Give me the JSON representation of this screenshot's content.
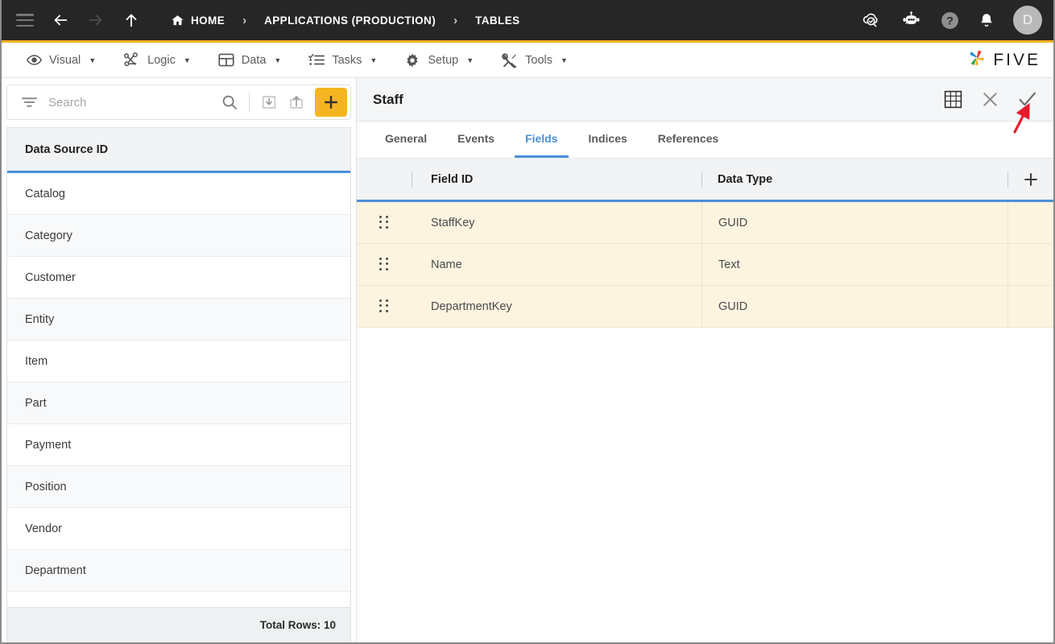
{
  "topbar": {
    "menu_icon": "hamburger-icon",
    "back_icon": "arrow-left-icon",
    "forward_icon": "arrow-right-icon",
    "up_icon": "arrow-up-icon",
    "breadcrumbs": [
      {
        "label": "HOME",
        "icon": "home-icon"
      },
      {
        "label": "APPLICATIONS (PRODUCTION)",
        "icon": ""
      },
      {
        "label": "TABLES",
        "icon": ""
      }
    ],
    "separator": "›",
    "right_icons": [
      {
        "name": "cloud-search-icon"
      },
      {
        "name": "robot-assistant-icon"
      },
      {
        "name": "help-icon"
      },
      {
        "name": "notifications-bell-icon"
      }
    ],
    "avatar_initial": "D",
    "accent_color": "#f5b120",
    "background_color": "#262626"
  },
  "menubar": {
    "items": [
      {
        "label": "Visual",
        "icon": "eye-icon",
        "caret": "▼"
      },
      {
        "label": "Logic",
        "icon": "logic-nodes-icon",
        "caret": "▼"
      },
      {
        "label": "Data",
        "icon": "table-grid-icon",
        "caret": "▼"
      },
      {
        "label": "Tasks",
        "icon": "checklist-icon",
        "caret": "▼"
      },
      {
        "label": "Setup",
        "icon": "gear-icon",
        "caret": "▼"
      },
      {
        "label": "Tools",
        "icon": "tools-icon",
        "caret": "▼"
      }
    ],
    "brand": {
      "name": "FIVE",
      "logo_icon": "five-pinwheel-logo"
    }
  },
  "sidebar": {
    "search": {
      "placeholder": "Search",
      "value": "",
      "filter_icon": "filter-icon",
      "search_icon": "search-icon",
      "import_icon": "import-icon",
      "export_icon": "export-icon",
      "add_icon": "plus-icon",
      "add_color": "#f5b520"
    },
    "column_header": "Data Source ID",
    "items": [
      {
        "label": "Catalog"
      },
      {
        "label": "Category"
      },
      {
        "label": "Customer"
      },
      {
        "label": "Entity"
      },
      {
        "label": "Item"
      },
      {
        "label": "Part"
      },
      {
        "label": "Payment"
      },
      {
        "label": "Position"
      },
      {
        "label": "Vendor"
      },
      {
        "label": "Department"
      }
    ],
    "footer": "Total Rows: 10"
  },
  "detail": {
    "title": "Staff",
    "actions": [
      {
        "name": "table-view-icon"
      },
      {
        "name": "close-icon"
      },
      {
        "name": "save-check-icon"
      }
    ],
    "tabs": [
      {
        "label": "General",
        "active": false
      },
      {
        "label": "Events",
        "active": false
      },
      {
        "label": "Fields",
        "active": true
      },
      {
        "label": "Indices",
        "active": false
      },
      {
        "label": "References",
        "active": false
      }
    ],
    "grid": {
      "columns": [
        "Field ID",
        "Data Type"
      ],
      "add_icon": "plus-icon",
      "drag_icon": "drag-handle-icon",
      "rows": [
        {
          "field_id": "StaffKey",
          "data_type": "GUID"
        },
        {
          "field_id": "Name",
          "data_type": "Text"
        },
        {
          "field_id": "DepartmentKey",
          "data_type": "GUID"
        }
      ],
      "row_highlight_color": "#fdf4e0",
      "header_underline_color": "#4a90d9"
    }
  },
  "annotation": {
    "arrow_color": "#e8192c",
    "points_to": "save-check-icon"
  }
}
